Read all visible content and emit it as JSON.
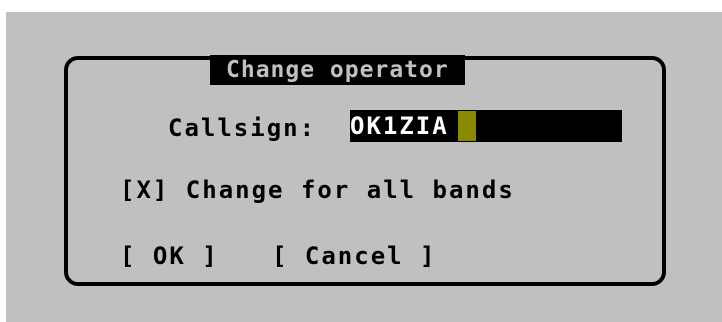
{
  "dialog": {
    "title": "Change operator",
    "callsign_label": "Callsign:",
    "callsign_value": "OK1ZIA",
    "checkbox_text": "[X] Change for all bands",
    "ok_label": "[ OK ]",
    "cancel_label": "[ Cancel ]"
  },
  "colors": {
    "background": "#c0c0c0",
    "frame": "#000000",
    "input_background": "#000000",
    "input_text": "#ffffff",
    "cursor": "#8a8a00"
  }
}
